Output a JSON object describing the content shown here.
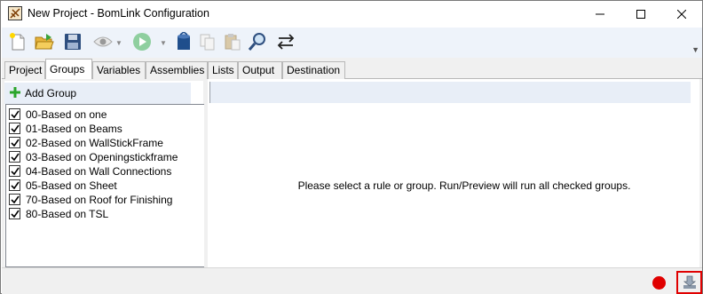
{
  "window": {
    "title": "New Project - BomLink Configuration",
    "icon": "bomlink-app-icon"
  },
  "title_controls": [
    "minimize-icon",
    "maximize-icon",
    "close-icon"
  ],
  "toolbar": {
    "buttons": [
      {
        "name": "new-project",
        "icon": "new-document-icon"
      },
      {
        "name": "open-project",
        "icon": "open-folder-icon"
      },
      {
        "name": "save-project",
        "icon": "save-disk-icon"
      },
      {
        "name": "preview",
        "icon": "eye-icon",
        "dropdown": true
      },
      {
        "name": "run",
        "icon": "play-icon",
        "dropdown": true
      },
      {
        "name": "database",
        "icon": "database-icon"
      },
      {
        "name": "copy",
        "icon": "copy-icon"
      },
      {
        "name": "paste",
        "icon": "paste-icon"
      },
      {
        "name": "search",
        "icon": "magnifier-icon"
      },
      {
        "name": "swap",
        "icon": "swap-arrows-icon"
      }
    ],
    "overflow_icon": "overflow-chevron-icon"
  },
  "tabs": [
    {
      "label": "Project",
      "active": false
    },
    {
      "label": "Groups",
      "active": true
    },
    {
      "label": "Variables",
      "active": false
    },
    {
      "label": "Assemblies",
      "active": false
    },
    {
      "label": "Lists",
      "active": false
    },
    {
      "label": "Output",
      "active": false
    },
    {
      "label": "Destination",
      "active": false
    }
  ],
  "groups_panel": {
    "add_label": "Add Group",
    "items": [
      {
        "label": "00-Based on one",
        "checked": true
      },
      {
        "label": "01-Based on Beams",
        "checked": true
      },
      {
        "label": "02-Based on WallStickFrame",
        "checked": true
      },
      {
        "label": "03-Based on Openingstickframe",
        "checked": true
      },
      {
        "label": "04-Based on Wall Connections",
        "checked": true
      },
      {
        "label": "05-Based on Sheet",
        "checked": true
      },
      {
        "label": "70-Based on Roof for Finishing",
        "checked": true
      },
      {
        "label": "80-Based on TSL",
        "checked": true
      }
    ]
  },
  "detail_panel": {
    "message": "Please select a rule or group. Run/Preview will run all checked groups."
  },
  "statusbar": {
    "indicator_color": "#e00000",
    "export_icon": "export-download-icon",
    "highlight_color": "#e00000"
  }
}
